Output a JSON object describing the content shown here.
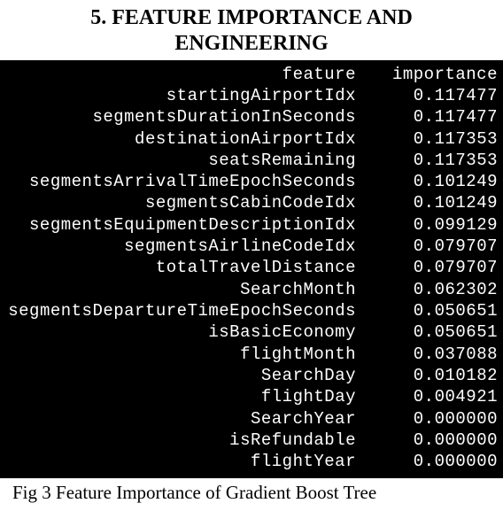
{
  "heading": {
    "number": "5.",
    "title_line1": "FEATURE IMPORTANCE AND",
    "title_line2": "ENGINEERING"
  },
  "terminal": {
    "header_feature": "feature",
    "header_importance": "importance",
    "rows": [
      {
        "feature": "startingAirportIdx",
        "importance": "0.117477"
      },
      {
        "feature": "segmentsDurationInSeconds",
        "importance": "0.117477"
      },
      {
        "feature": "destinationAirportIdx",
        "importance": "0.117353"
      },
      {
        "feature": "seatsRemaining",
        "importance": "0.117353"
      },
      {
        "feature": "segmentsArrivalTimeEpochSeconds",
        "importance": "0.101249"
      },
      {
        "feature": "segmentsCabinCodeIdx",
        "importance": "0.101249"
      },
      {
        "feature": "segmentsEquipmentDescriptionIdx",
        "importance": "0.099129"
      },
      {
        "feature": "segmentsAirlineCodeIdx",
        "importance": "0.079707"
      },
      {
        "feature": "totalTravelDistance",
        "importance": "0.079707"
      },
      {
        "feature": "SearchMonth",
        "importance": "0.062302"
      },
      {
        "feature": "segmentsDepartureTimeEpochSeconds",
        "importance": "0.050651"
      },
      {
        "feature": "isBasicEconomy",
        "importance": "0.050651"
      },
      {
        "feature": "flightMonth",
        "importance": "0.037088"
      },
      {
        "feature": "SearchDay",
        "importance": "0.010182"
      },
      {
        "feature": "flightDay",
        "importance": "0.004921"
      },
      {
        "feature": "SearchYear",
        "importance": "0.000000"
      },
      {
        "feature": "isRefundable",
        "importance": "0.000000"
      },
      {
        "feature": "flightYear",
        "importance": "0.000000"
      }
    ]
  },
  "caption": "Fig 3 Feature Importance of Gradient Boost Tree",
  "chart_data": {
    "type": "table",
    "title": "Feature Importance of Gradient Boost Tree",
    "columns": [
      "feature",
      "importance"
    ],
    "rows": [
      [
        "startingAirportIdx",
        0.117477
      ],
      [
        "segmentsDurationInSeconds",
        0.117477
      ],
      [
        "destinationAirportIdx",
        0.117353
      ],
      [
        "seatsRemaining",
        0.117353
      ],
      [
        "segmentsArrivalTimeEpochSeconds",
        0.101249
      ],
      [
        "segmentsCabinCodeIdx",
        0.101249
      ],
      [
        "segmentsEquipmentDescriptionIdx",
        0.099129
      ],
      [
        "segmentsAirlineCodeIdx",
        0.079707
      ],
      [
        "totalTravelDistance",
        0.079707
      ],
      [
        "SearchMonth",
        0.062302
      ],
      [
        "segmentsDepartureTimeEpochSeconds",
        0.050651
      ],
      [
        "isBasicEconomy",
        0.050651
      ],
      [
        "flightMonth",
        0.037088
      ],
      [
        "SearchDay",
        0.010182
      ],
      [
        "flightDay",
        0.004921
      ],
      [
        "SearchYear",
        0.0
      ],
      [
        "isRefundable",
        0.0
      ],
      [
        "flightYear",
        0.0
      ]
    ]
  }
}
